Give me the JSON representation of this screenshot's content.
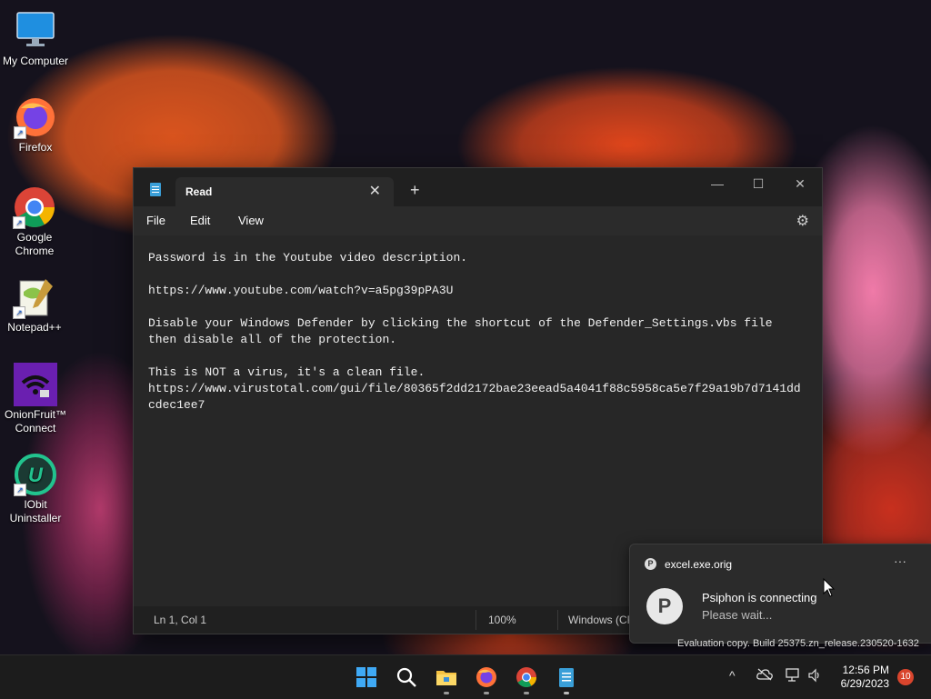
{
  "desktop": {
    "icons": [
      {
        "label": "My Computer",
        "icon": "monitor-icon"
      },
      {
        "label": "Firefox",
        "icon": "firefox-icon"
      },
      {
        "label": "Google Chrome",
        "icon": "chrome-icon"
      },
      {
        "label": "Notepad++",
        "icon": "notepadpp-icon"
      },
      {
        "label": "OnionFruit™ Connect",
        "icon": "onionfruit-icon"
      },
      {
        "label": "IObit Uninstaller",
        "icon": "iobit-icon"
      }
    ],
    "shortcut_glyph": "↗"
  },
  "notepad": {
    "tab_title": "Read",
    "tab_close": "✕",
    "new_tab": "+",
    "minimize": "—",
    "maximize": "☐",
    "close": "✕",
    "menu": {
      "file": "File",
      "edit": "Edit",
      "view": "View"
    },
    "settings_glyph": "⚙",
    "content_lines": [
      "Password is in the Youtube video description.",
      "",
      "https://www.youtube.com/watch?v=a5pg39pPA3U",
      "",
      "Disable your Windows Defender by clicking the shortcut of the Defender_Settings.vbs file",
      "then disable all of the protection.",
      "",
      "This is NOT a virus, it's a clean file.",
      "https://www.virustotal.com/gui/file/80365f2dd2172bae23eead5a4041f88c5958ca5e7f29a19b7d7141dd",
      "cdec1ee7"
    ],
    "status": {
      "position": "Ln 1, Col 1",
      "zoom": "100%",
      "line_ending": "Windows (CR"
    }
  },
  "toast": {
    "app_name": "excel.exe.orig",
    "app_glyph": "P",
    "more": "···",
    "title": "Psiphon is connecting",
    "body": "Please wait..."
  },
  "watermark": "Evaluation copy. Build 25375.zn_release.230520-1632",
  "taskbar": {
    "tray_chevron": "^",
    "time": "12:56 PM",
    "date": "6/29/2023",
    "notifications": "10"
  },
  "colors": {
    "accent": "#3a9fd8",
    "badge": "#d9452d"
  }
}
